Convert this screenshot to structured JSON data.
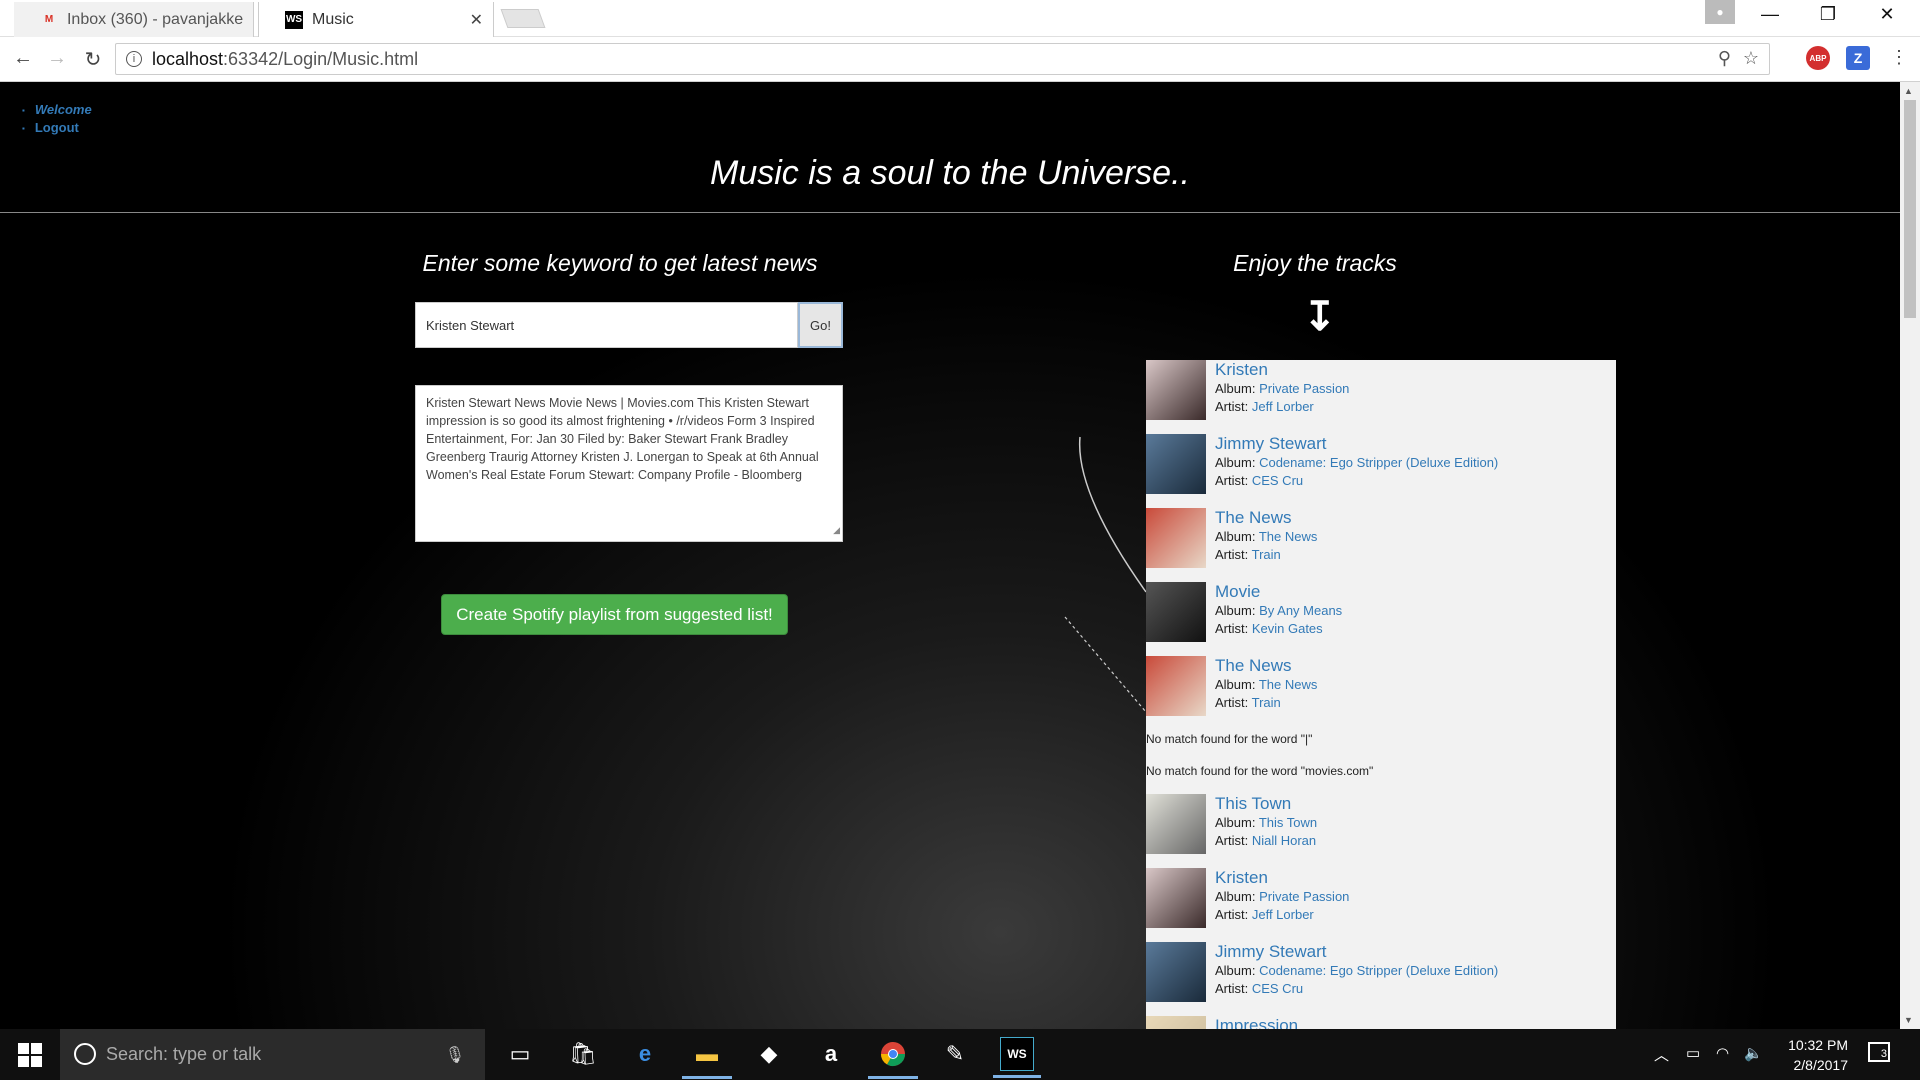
{
  "browser": {
    "tabs": [
      {
        "title": "Inbox (360) - pavanjakke",
        "icon": "gmail-icon"
      },
      {
        "title": "Music",
        "icon": "webstorm-icon"
      }
    ],
    "favicon_labels": {
      "gmail": "M",
      "webstorm": "WS"
    },
    "url_host": "localhost",
    "url_path": ":63342/Login/Music.html",
    "extensions": {
      "abp": "ABP",
      "z": "Z"
    }
  },
  "nav": {
    "welcome": "Welcome",
    "logout": "Logout"
  },
  "page": {
    "headline": "Music is a soul to the Universe..",
    "news_title": "Enter some keyword to get latest news",
    "search_value": "Kristen Stewart",
    "go_label": "Go!",
    "news_text": "Kristen Stewart News   Movie News | Movies.com This Kristen Stewart impression is so good its almost frightening • /r/videos Form 3 Inspired Entertainment, For: Jan 30 Filed by: Baker Stewart Frank Bradley Greenberg Traurig Attorney Kristen J. Lonergan to Speak at 6th Annual Women's Real Estate Forum Stewart: Company Profile - Bloomberg",
    "spotify_button": "Create Spotify playlist from suggested list!",
    "tracks_title": "Enjoy the tracks",
    "album_label": "Album: ",
    "artist_label": "Artist: "
  },
  "tracks": [
    {
      "kind": "track",
      "name": "Kristen",
      "album": "Private Passion",
      "artist": "Jeff Lorber",
      "art": [
        "#d9c7c7",
        "#3a2a2a"
      ]
    },
    {
      "kind": "track",
      "name": "Jimmy Stewart",
      "album": "Codename: Ego Stripper (Deluxe Edition)",
      "artist": "CES Cru",
      "art": [
        "#5a7a9a",
        "#1a2a3a"
      ]
    },
    {
      "kind": "track",
      "name": "The News",
      "album": "The News",
      "artist": "Train",
      "art": [
        "#c94a3a",
        "#e8d8c8"
      ]
    },
    {
      "kind": "track",
      "name": "Movie",
      "album": "By Any Means",
      "artist": "Kevin Gates",
      "art": [
        "#555",
        "#111"
      ]
    },
    {
      "kind": "track",
      "name": "The News",
      "album": "The News",
      "artist": "Train",
      "art": [
        "#c94a3a",
        "#e8d8c8"
      ]
    },
    {
      "kind": "nomatch",
      "text": "No match found for the word \"|\""
    },
    {
      "kind": "nomatch",
      "text": "No match found for the word \"movies.com\""
    },
    {
      "kind": "track",
      "name": "This Town",
      "album": "This Town",
      "artist": "Niall Horan",
      "art": [
        "#e0e0d8",
        "#666"
      ]
    },
    {
      "kind": "track",
      "name": "Kristen",
      "album": "Private Passion",
      "artist": "Jeff Lorber",
      "art": [
        "#d9c7c7",
        "#3a2a2a"
      ]
    },
    {
      "kind": "track",
      "name": "Jimmy Stewart",
      "album": "Codename: Ego Stripper (Deluxe Edition)",
      "artist": "CES Cru",
      "art": [
        "#5a7a9a",
        "#1a2a3a"
      ]
    },
    {
      "kind": "track",
      "name": "Impression",
      "album": "",
      "artist": "",
      "art": [
        "#e8d8b8",
        "#c8b898"
      ]
    }
  ],
  "taskbar": {
    "search_placeholder": "Search: type or talk",
    "time": "10:32 PM",
    "date": "2/8/2017",
    "notifications": "3",
    "apps": [
      "task-view-icon",
      "store-icon",
      "edge-icon",
      "file-explorer-icon",
      "dropbox-icon",
      "amazon-icon",
      "chrome-icon",
      "app-icon",
      "webstorm-icon"
    ]
  },
  "colors": {
    "link": "#337ab7",
    "success": "#4cae4c",
    "panel": "#f2f2f2"
  }
}
